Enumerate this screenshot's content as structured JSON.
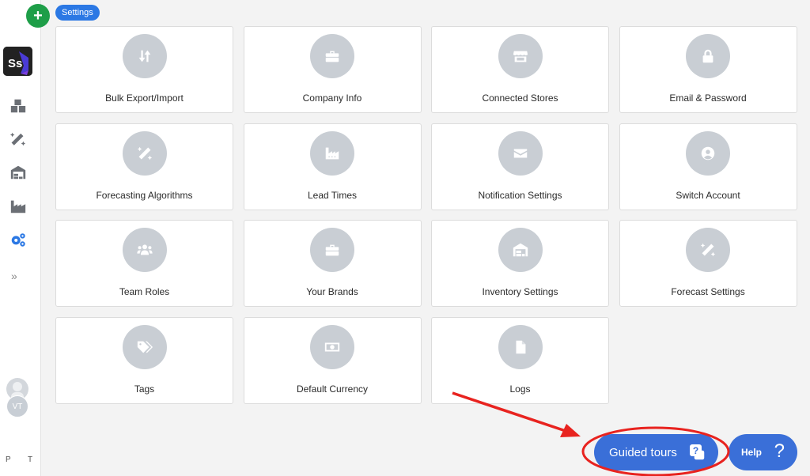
{
  "app": {
    "breadcrumb": "Settings",
    "add_button_icon": "plus-icon",
    "logo_text": "Ss"
  },
  "sidebar": {
    "items": [
      {
        "name": "inventory-boxes",
        "icon": "boxes-icon",
        "active": false
      },
      {
        "name": "forecasting",
        "icon": "magic-wand-icon",
        "active": false
      },
      {
        "name": "warehouse",
        "icon": "warehouse-icon",
        "active": false
      },
      {
        "name": "suppliers",
        "icon": "factory-icon",
        "active": false
      },
      {
        "name": "settings",
        "icon": "gears-icon",
        "active": true
      }
    ],
    "expand_label": "»",
    "user_initials": "VT",
    "bottom_left": "P",
    "bottom_right": "T",
    "active_color": "#2b78e4"
  },
  "settings_cards": [
    {
      "label": "Bulk Export/Import",
      "icon": "sort-arrows-icon"
    },
    {
      "label": "Company Info",
      "icon": "briefcase-icon"
    },
    {
      "label": "Connected Stores",
      "icon": "store-icon"
    },
    {
      "label": "Email & Password",
      "icon": "lock-icon"
    },
    {
      "label": "Forecasting Algorithms",
      "icon": "magic-wand-icon"
    },
    {
      "label": "Lead Times",
      "icon": "factory-icon"
    },
    {
      "label": "Notification Settings",
      "icon": "envelope-icon"
    },
    {
      "label": "Switch Account",
      "icon": "user-circle-icon"
    },
    {
      "label": "Team Roles",
      "icon": "users-icon"
    },
    {
      "label": "Your Brands",
      "icon": "briefcase-icon"
    },
    {
      "label": "Inventory Settings",
      "icon": "warehouse-icon"
    },
    {
      "label": "Forecast Settings",
      "icon": "magic-wand-icon"
    },
    {
      "label": "Tags",
      "icon": "tags-icon"
    },
    {
      "label": "Default Currency",
      "icon": "money-bill-icon"
    },
    {
      "label": "Logs",
      "icon": "file-icon"
    }
  ],
  "footer_buttons": {
    "guided_tours": "Guided tours",
    "help": "Help",
    "help_icon": "?",
    "button_color": "#3a6fd8"
  },
  "annotation": {
    "color": "#e8231f",
    "type": "arrow-and-ellipse",
    "target": "guided-tours-button"
  }
}
